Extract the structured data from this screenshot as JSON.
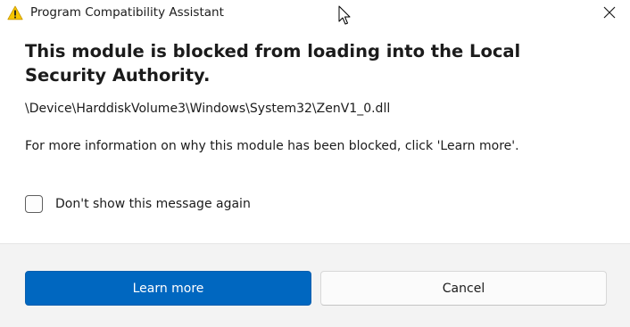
{
  "window": {
    "title": "Program Compatibility Assistant",
    "title_icon": "warning-icon",
    "close_icon": "close-icon"
  },
  "content": {
    "heading": "This module is blocked from loading into the Local Security Authority.",
    "module_path": "\\Device\\HarddiskVolume3\\Windows\\System32\\ZenV1_0.dll",
    "info": "For more information on why this module has been blocked, click 'Learn more'.",
    "checkbox_label": "Don't show this message again",
    "checkbox_checked": false
  },
  "buttons": {
    "learn_more": "Learn more",
    "cancel": "Cancel"
  },
  "colors": {
    "primary": "#0067c0",
    "warning": "#f7c600",
    "footer_bg": "#f3f3f3"
  }
}
